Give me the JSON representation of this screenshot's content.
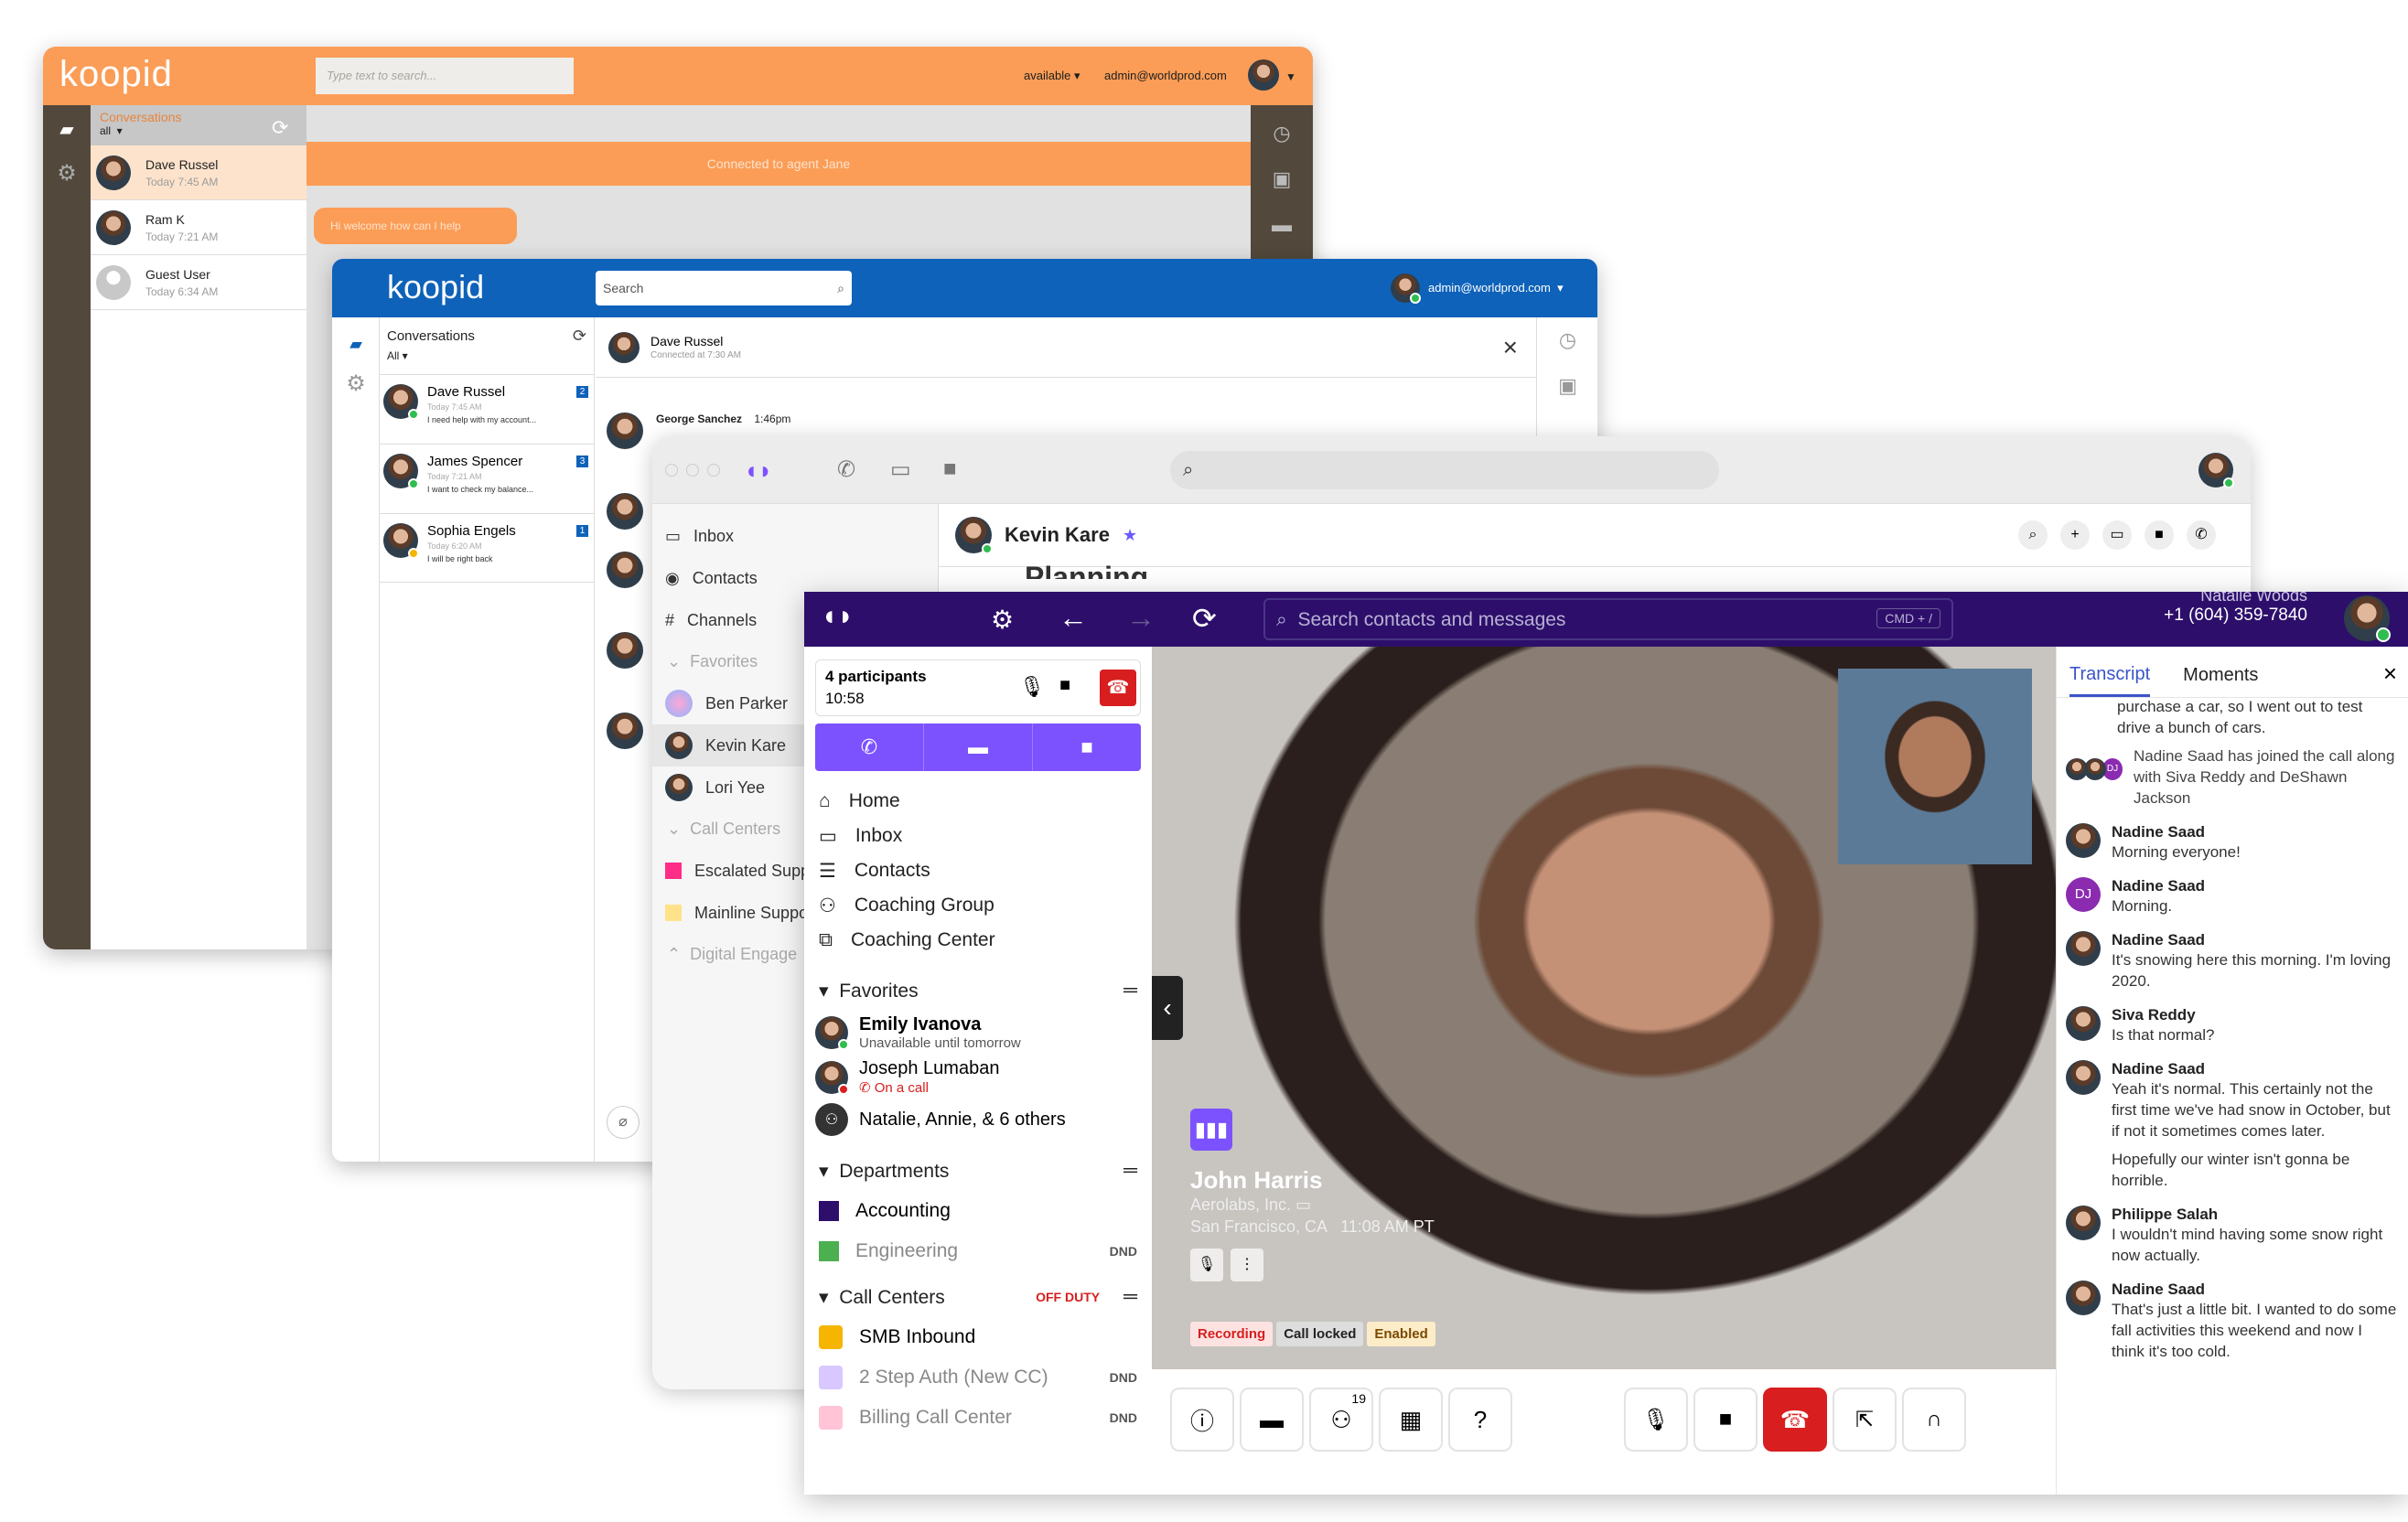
{
  "w1": {
    "logo": "koopid",
    "search_placeholder": "Type text to search...",
    "status": "available",
    "email": "admin@worldprod.com",
    "conversations_label": "Conversations",
    "filter": "all",
    "contacts": [
      {
        "name": "Dave Russel",
        "time": "Today 7:45 AM"
      },
      {
        "name": "Ram K",
        "time": "Today 7:21 AM"
      },
      {
        "name": "Guest User",
        "time": "Today 6:34 AM"
      }
    ],
    "banner": "Connected to agent Jane",
    "bubble": "Hi welcome how can I help"
  },
  "w2": {
    "logo": "koopid",
    "search_placeholder": "Search",
    "email": "admin@worldprod.com",
    "conversations_label": "Conversations",
    "filter": "All",
    "contacts": [
      {
        "name": "Dave Russel",
        "time": "Today 7:45 AM",
        "preview": "I need help with my account...",
        "badge": "2"
      },
      {
        "name": "James Spencer",
        "time": "Today 7:21 AM",
        "preview": "I want to check my balance...",
        "badge": "3"
      },
      {
        "name": "Sophia Engels",
        "time": "Today 6:20 AM",
        "preview": "I will be right back",
        "badge": "1"
      }
    ],
    "chat_name": "Dave Russel",
    "chat_sub": "Connected at 7:30 AM",
    "msg_sender": "George Sanchez",
    "msg_time": "1:46pm"
  },
  "w3": {
    "nav": [
      "Inbox",
      "Contacts",
      "Channels"
    ],
    "favorites_label": "Favorites",
    "favorites": [
      "Ben Parker",
      "Kevin Kare",
      "Lori Yee"
    ],
    "call_centers_label": "Call Centers",
    "call_centers": [
      "Escalated Supp",
      "Mainline Suppo"
    ],
    "digital_label": "Digital Engage",
    "header_name": "Kevin Kare",
    "partial_text": "Planning"
  },
  "w4": {
    "search_placeholder": "Search contacts and messages",
    "shortcut": "CMD + /",
    "user_name": "Natalie Woods",
    "user_phone": "+1 (604) 359-7840",
    "call": {
      "participants": "4 participants",
      "timer": "10:58"
    },
    "nav": [
      "Home",
      "Inbox",
      "Contacts",
      "Coaching Group",
      "Coaching Center"
    ],
    "favorites_label": "Favorites",
    "favorites": [
      {
        "name": "Emily Ivanova",
        "sub": "Unavailable until tomorrow"
      },
      {
        "name": "Joseph Lumaban",
        "sub": "On a call"
      },
      {
        "name": "Natalie, Annie, & 6 others",
        "sub": ""
      }
    ],
    "departments_label": "Departments",
    "departments": [
      {
        "name": "Accounting",
        "tag": ""
      },
      {
        "name": "Engineering",
        "tag": "DND"
      }
    ],
    "call_centers_label": "Call Centers",
    "off_duty": "OFF DUTY",
    "call_centers": [
      {
        "name": "SMB Inbound",
        "tag": "",
        "color": "#f6b500"
      },
      {
        "name": "2 Step Auth (New CC)",
        "tag": "DND",
        "color": "#d8c8ff"
      },
      {
        "name": "Billing Call Center",
        "tag": "DND",
        "color": "#ffc4d6"
      }
    ],
    "caller": {
      "name": "John Harris",
      "company": "Aerolabs, Inc.",
      "location": "San Francisco, CA",
      "time": "11:08 AM PT"
    },
    "badges": [
      "Recording",
      "Call locked",
      "Enabled"
    ],
    "participant_count": "19",
    "tabs": [
      "Transcript",
      "Moments"
    ],
    "transcript": [
      {
        "name": "",
        "text": "purchase a car, so I went out to test drive a bunch of cars."
      },
      {
        "name": "",
        "text": "Nadine Saad has joined the call along with Siva Reddy and DeShawn Jackson"
      },
      {
        "name": "Nadine Saad",
        "text": "Morning everyone!"
      },
      {
        "name": "Nadine Saad",
        "text": "Morning."
      },
      {
        "name": "Nadine Saad",
        "text": "It's snowing here this morning. I'm loving 2020."
      },
      {
        "name": "Siva Reddy",
        "text": "Is that normal?"
      },
      {
        "name": "Nadine Saad",
        "text": "Yeah it's normal. This certainly not the first time we've had snow in October, but if not it sometimes comes later."
      },
      {
        "name": "",
        "text": "Hopefully our winter isn't gonna be horrible."
      },
      {
        "name": "Philippe Salah",
        "text": "I wouldn't mind having some snow right now actually."
      },
      {
        "name": "Nadine Saad",
        "text": "That's just a little bit. I wanted to do some fall activities this weekend and now I think it's too cold."
      }
    ],
    "dj_initials": "DJ"
  }
}
